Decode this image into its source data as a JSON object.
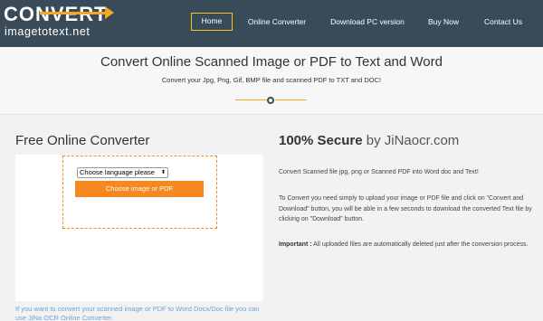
{
  "header": {
    "logo_top": "CONVERT",
    "logo_bottom": "imagetotext.net",
    "nav": [
      {
        "label": "Home",
        "active": true
      },
      {
        "label": "Online Converter"
      },
      {
        "label": "Download PC version"
      },
      {
        "label": "Buy Now"
      },
      {
        "label": "Contact Us"
      }
    ]
  },
  "hero": {
    "title": "Convert Online Scanned Image or PDF to Text and Word",
    "subtitle": "Convert your Jpg, Png, Gif, BMP file and scanned PDF to TXT and DOC!"
  },
  "converter": {
    "heading": "Free Online Converter",
    "language_select": "Choose language please",
    "choose_button": "Choose image or PDF",
    "note": "If you want to convert your scanned image or PDF to Word Docx/Doc file you can use JiNa OCR Online Converter."
  },
  "info": {
    "heading_strong": "100% Secure",
    "heading_by": " by JiNaocr.com",
    "p1": "Convert Scanned file jpg, png or Scanned PDF into Word doc and Text!",
    "p2": "To Convert you need simply to upload your image or PDF file and click on \"Convert and Download\" button, you will be able in a few seconds to download the converted Text file by clicking on \"Download\" button.",
    "p3_label": "Important :",
    "p3_text": " All uploaded files are automatically deleted just after the conversion process."
  },
  "colors": {
    "header_bg": "#394b59",
    "accent_orange": "#f5881f",
    "nav_highlight": "#f5c518",
    "link_blue": "#6aa3d5"
  }
}
